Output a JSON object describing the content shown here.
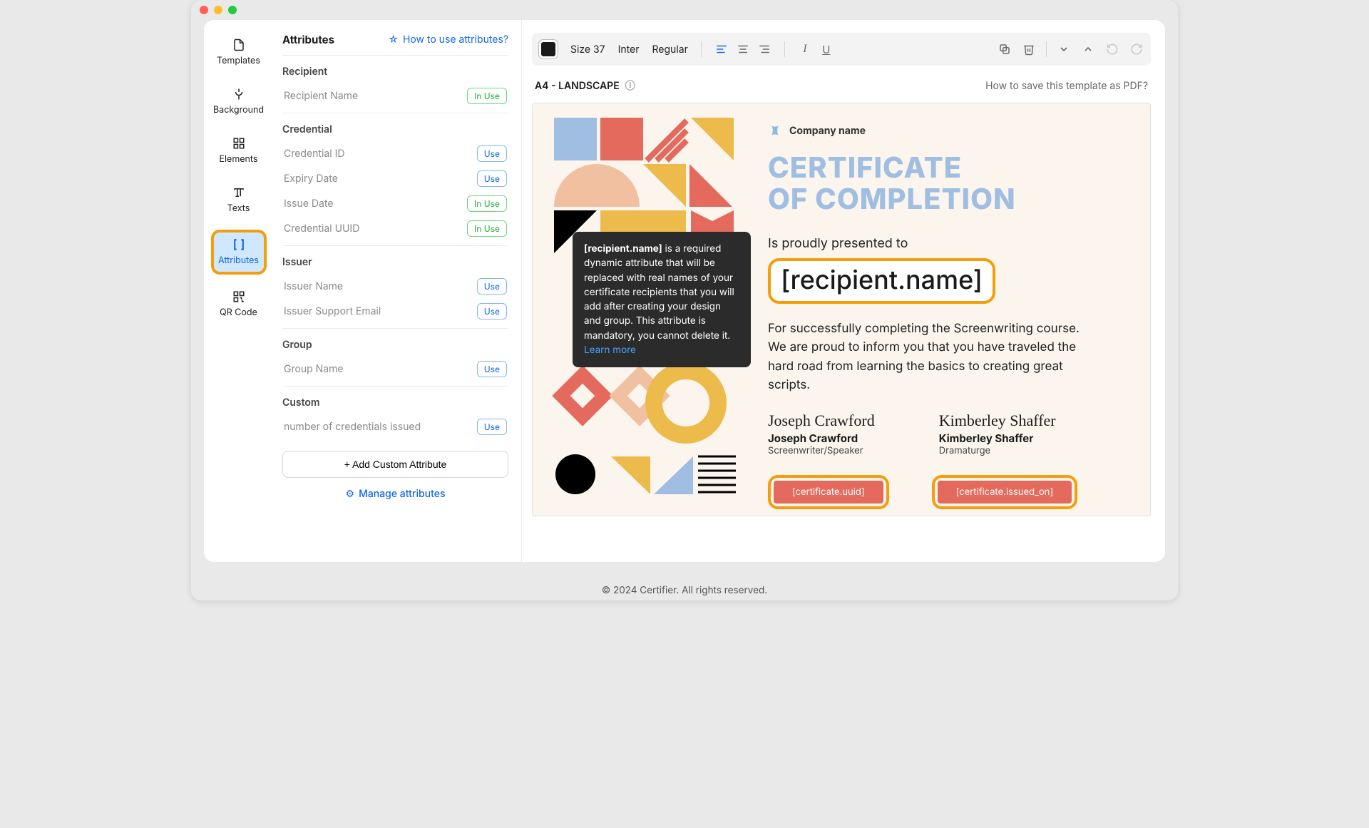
{
  "sidebar": {
    "items": [
      {
        "label": "Templates"
      },
      {
        "label": "Background"
      },
      {
        "label": "Elements"
      },
      {
        "label": "Texts"
      },
      {
        "label": "Attributes"
      },
      {
        "label": "QR Code"
      }
    ]
  },
  "panel": {
    "title": "Attributes",
    "help": "How to use attributes?",
    "sections": [
      {
        "title": "Recipient",
        "items": [
          {
            "label": "Recipient Name",
            "status": "In Use"
          }
        ]
      },
      {
        "title": "Credential",
        "items": [
          {
            "label": "Credential ID",
            "status": "Use"
          },
          {
            "label": "Expiry Date",
            "status": "Use"
          },
          {
            "label": "Issue Date",
            "status": "In Use"
          },
          {
            "label": "Credential UUID",
            "status": "In Use"
          }
        ]
      },
      {
        "title": "Issuer",
        "items": [
          {
            "label": "Issuer Name",
            "status": "Use"
          },
          {
            "label": "Issuer Support Email",
            "status": "Use"
          }
        ]
      },
      {
        "title": "Group",
        "items": [
          {
            "label": "Group Name",
            "status": "Use"
          }
        ]
      },
      {
        "title": "Custom",
        "items": [
          {
            "label": "number of credentials issued",
            "status": "Use"
          }
        ]
      }
    ],
    "addButton": "+ Add Custom Attribute",
    "manageLink": "Manage attributes"
  },
  "toolbar": {
    "size": "Size 37",
    "font": "Inter",
    "weight": "Regular"
  },
  "meta": {
    "pageFormat": "A4 - LANDSCAPE",
    "saveHelp": "How to save this template as PDF?"
  },
  "tooltip": {
    "strong": "[recipient.name]",
    "body": " is a required dynamic attribute that will be replaced with real names of your certificate recipients that you will add after creating your design and group. This attribute is mandatory, you cannot delete it.",
    "link": "Learn more"
  },
  "certificate": {
    "company": "Company name",
    "titleLine1": "CERTIFICATE",
    "titleLine2": "OF COMPLETION",
    "presented": "Is proudly presented to",
    "recipientToken": "[recipient.name]",
    "body": "For successfully completing the Screenwriting course. We are proud to inform you that you have traveled the hard road from learning the basics to creating great scripts.",
    "sigs": [
      {
        "script": "Joseph Crawford",
        "name": "Joseph Crawford",
        "role": "Screenwriter/Speaker"
      },
      {
        "script": "Kimberley Shaffer",
        "name": "Kimberley Shaffer",
        "role": "Dramaturge"
      }
    ],
    "tokens": [
      "[certificate.uuid]",
      "[certificate.issued_on]"
    ]
  },
  "footer": "© 2024 Certifier. All rights reserved."
}
